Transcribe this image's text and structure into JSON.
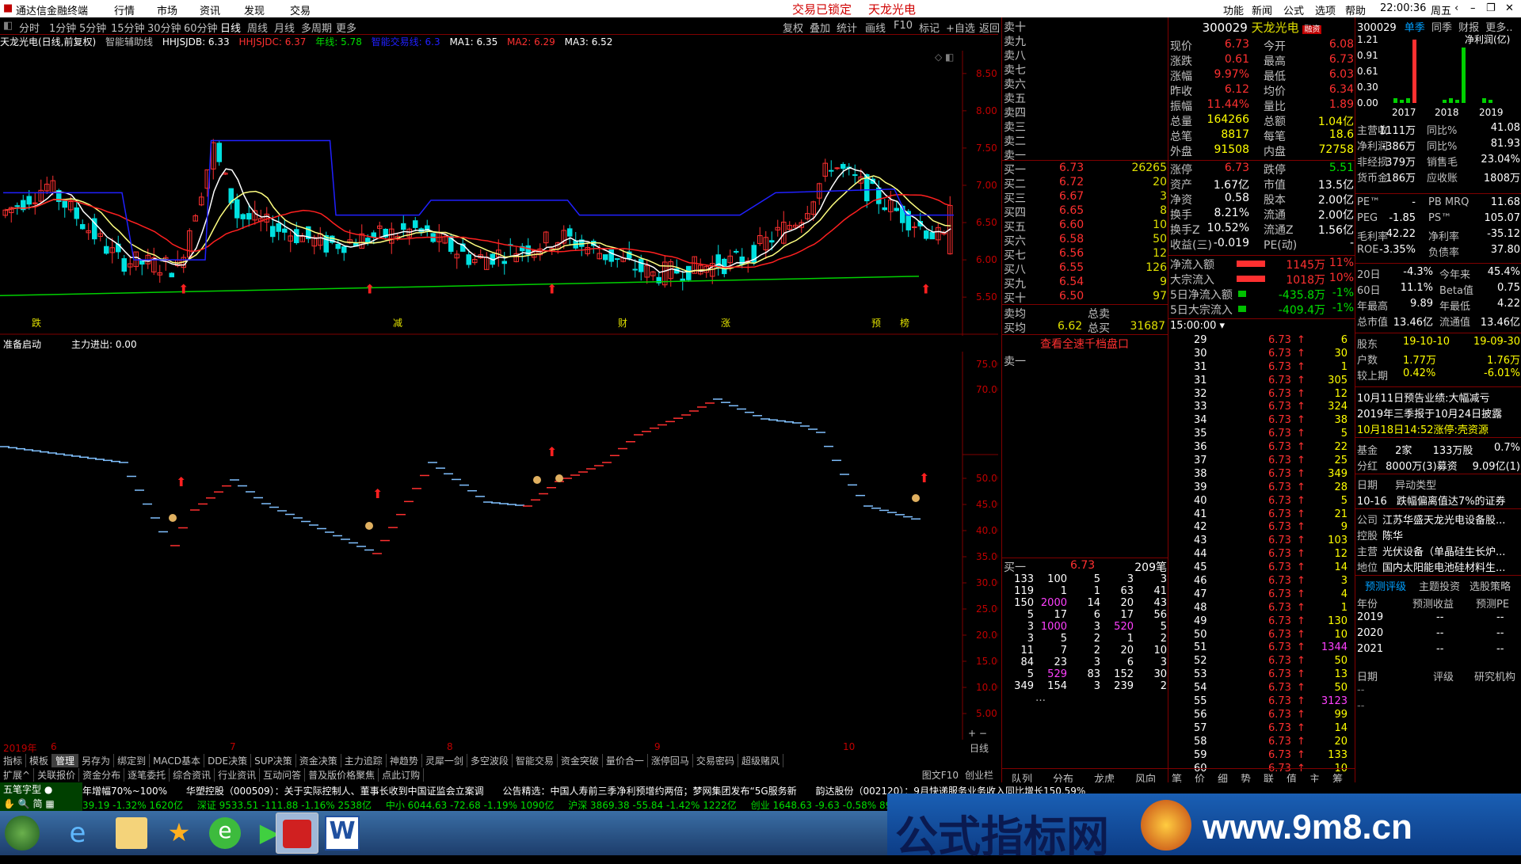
{
  "menubar": {
    "app_title": "通达信金融终端",
    "menus": [
      "行情",
      "市场",
      "资讯",
      "发现",
      "交易"
    ],
    "center_status": "交易已锁定",
    "center_stock": "天龙光电",
    "right_menus": [
      "功能",
      "新闻",
      "公式",
      "选项",
      "帮助"
    ],
    "time": "22:00:36",
    "weekday": "周五"
  },
  "periodbar": {
    "periods": [
      "分时",
      "1分钟",
      "5分钟",
      "15分钟",
      "30分钟",
      "60分钟",
      "日线",
      "周线",
      "月线",
      "多周期",
      "更多"
    ],
    "tools": [
      "复权",
      "叠加",
      "统计",
      "画线",
      "F10",
      "标记",
      "+自选",
      "返回"
    ]
  },
  "indicator_line": {
    "title": "天龙光电(日线,前复权)",
    "aux": "智能辅助线",
    "hhjsjdb": "HHJSJDB: 6.33",
    "hhjsjdc": "HHJSJDC: 6.37",
    "yearline": "年线: 5.78",
    "smart": "智能交易线: 6.3",
    "ma1": "MA1: 6.35",
    "ma2": "MA2: 6.29",
    "ma3": "MA3: 6.52"
  },
  "main_chart": {
    "price_axis": [
      "8.50",
      "8.00",
      "7.50",
      "7.00",
      "6.50",
      "6.00",
      "5.50"
    ],
    "bottom_labels": [
      "跌",
      "减",
      "财",
      "涨",
      "预",
      "榜"
    ]
  },
  "sub_indicator": {
    "name": "准备启动",
    "value": "主力进出: 0.00",
    "axis_top": [
      "75.00",
      "70.00"
    ],
    "axis_bottom": [
      "50.00",
      "45.00",
      "40.00",
      "35.00",
      "30.00",
      "25.00",
      "20.00",
      "15.00",
      "10.00",
      "5.00"
    ]
  },
  "xaxis": {
    "labels": [
      "2019年",
      "6",
      "7",
      "8",
      "9",
      "10"
    ],
    "right": "日线"
  },
  "tabs1": [
    "指标",
    "模板",
    "管理",
    "另存为",
    "绑定到",
    "MACD基本",
    "DDE决策",
    "SUP决策",
    "资金决策",
    "主力追踪",
    "神趋势",
    "灵犀一剑",
    "多空波段",
    "智能交易",
    "资金突破",
    "量价合一",
    "涨停回马",
    "交易密码",
    "超级赌风"
  ],
  "tabs2": [
    "扩展^",
    "关联报价",
    "资金分布",
    "逐笔委托",
    "综合资讯",
    "行业资讯",
    "互动问答",
    "普及版价格聚焦",
    "点此订购"
  ],
  "tabs2_right": [
    "图文F10",
    "创业栏"
  ],
  "order_book": {
    "sells": [
      "卖十",
      "卖九",
      "卖八",
      "卖七",
      "卖六",
      "卖五",
      "卖四",
      "卖三",
      "卖二",
      "卖一"
    ],
    "buys": [
      {
        "label": "买一",
        "price": "6.73",
        "vol": "26265"
      },
      {
        "label": "买二",
        "price": "6.72",
        "vol": "20"
      },
      {
        "label": "买三",
        "price": "6.67",
        "vol": "3"
      },
      {
        "label": "买四",
        "price": "6.65",
        "vol": "8"
      },
      {
        "label": "买五",
        "price": "6.60",
        "vol": "10"
      },
      {
        "label": "买六",
        "price": "6.58",
        "vol": "50"
      },
      {
        "label": "买七",
        "price": "6.56",
        "vol": "12"
      },
      {
        "label": "买八",
        "price": "6.55",
        "vol": "126"
      },
      {
        "label": "买九",
        "price": "6.54",
        "vol": "9"
      },
      {
        "label": "买十",
        "price": "6.50",
        "vol": "97"
      }
    ],
    "sell_avg": "卖均",
    "buy_avg": "买均",
    "buy_avg_price": "6.62",
    "total_sell": "总卖",
    "total_buy": "总买",
    "total_buy_val": "31687",
    "link": "查看全速千档盘口",
    "sell1_label": "卖一",
    "buy1_detail": {
      "label": "买一",
      "price": "6.73",
      "count": "209笔"
    },
    "queue": [
      [
        "133",
        "100",
        "5",
        "3",
        "3"
      ],
      [
        "119",
        "1",
        "1",
        "63",
        "41"
      ],
      [
        "150",
        "2000",
        "14",
        "20",
        "43"
      ],
      [
        "5",
        "17",
        "6",
        "17",
        "56"
      ],
      [
        "3",
        "1000",
        "3",
        "520",
        "5"
      ],
      [
        "3",
        "5",
        "2",
        "1",
        "2"
      ],
      [
        "11",
        "7",
        "2",
        "20",
        "10"
      ],
      [
        "84",
        "23",
        "3",
        "6",
        "3"
      ],
      [
        "5",
        "529",
        "83",
        "152",
        "30"
      ],
      [
        "349",
        "154",
        "3",
        "239",
        "2"
      ]
    ],
    "bottom_tabs": [
      "队列",
      "分布",
      "龙虎",
      "风向"
    ]
  },
  "quote": {
    "code": "300029",
    "name": "天龙光电",
    "badge": "融资",
    "rows": [
      [
        "现价",
        "6.73",
        "今开",
        "6.08"
      ],
      [
        "涨跌",
        "0.61",
        "最高",
        "6.73"
      ],
      [
        "涨幅",
        "9.97%",
        "最低",
        "6.03"
      ],
      [
        "昨收",
        "6.12",
        "均价",
        "6.34"
      ],
      [
        "振幅",
        "11.44%",
        "量比",
        "1.89"
      ],
      [
        "总量",
        "164266",
        "总额",
        "1.04亿"
      ],
      [
        "总笔",
        "8817",
        "每笔",
        "18.6"
      ],
      [
        "外盘",
        "91508",
        "内盘",
        "72758"
      ]
    ],
    "rows2": [
      [
        "涨停",
        "6.73",
        "跌停",
        "5.51"
      ],
      [
        "资产",
        "1.67亿",
        "市值",
        "13.5亿"
      ],
      [
        "净资",
        "0.58",
        "股本",
        "2.00亿"
      ],
      [
        "换手",
        "8.21%",
        "流通",
        "2.00亿"
      ],
      [
        "换手Z",
        "10.52%",
        "流通Z",
        "1.56亿"
      ],
      [
        "收益(三)",
        "-0.019",
        "PE(动)",
        "-"
      ]
    ],
    "flows": [
      [
        "净流入额",
        "1145万",
        "11%"
      ],
      [
        "大宗流入",
        "1018万",
        "10%"
      ],
      [
        "5日净流入额",
        "-435.8万",
        "-1%"
      ],
      [
        "5日大宗流入",
        "-409.4万",
        "-1%"
      ]
    ]
  },
  "ticks": {
    "header": "15:00:00",
    "rows": [
      [
        "29",
        "6.73",
        "6"
      ],
      [
        "30",
        "6.73",
        "30"
      ],
      [
        "31",
        "6.73",
        "1"
      ],
      [
        "31",
        "6.73",
        "305"
      ],
      [
        "32",
        "6.73",
        "12"
      ],
      [
        "33",
        "6.73",
        "324"
      ],
      [
        "34",
        "6.73",
        "38"
      ],
      [
        "35",
        "6.73",
        "5"
      ],
      [
        "36",
        "6.73",
        "22"
      ],
      [
        "37",
        "6.73",
        "25"
      ],
      [
        "38",
        "6.73",
        "349"
      ],
      [
        "39",
        "6.73",
        "28"
      ],
      [
        "40",
        "6.73",
        "5"
      ],
      [
        "41",
        "6.73",
        "21"
      ],
      [
        "42",
        "6.73",
        "9"
      ],
      [
        "43",
        "6.73",
        "103"
      ],
      [
        "44",
        "6.73",
        "12"
      ],
      [
        "45",
        "6.73",
        "14"
      ],
      [
        "46",
        "6.73",
        "3"
      ],
      [
        "47",
        "6.73",
        "4"
      ],
      [
        "48",
        "6.73",
        "1"
      ],
      [
        "49",
        "6.73",
        "130"
      ],
      [
        "50",
        "6.73",
        "10"
      ],
      [
        "51",
        "6.73",
        "1344"
      ],
      [
        "52",
        "6.73",
        "50"
      ],
      [
        "53",
        "6.73",
        "13"
      ],
      [
        "54",
        "6.73",
        "50"
      ],
      [
        "55",
        "6.73",
        "3123"
      ],
      [
        "56",
        "6.73",
        "99"
      ],
      [
        "57",
        "6.73",
        "14"
      ],
      [
        "58",
        "6.73",
        "20"
      ],
      [
        "59",
        "6.73",
        "133"
      ],
      [
        "60",
        "6.73",
        "10"
      ]
    ],
    "bottom_tabs": [
      "笔",
      "价",
      "细",
      "势",
      "联",
      "值",
      "主",
      "筹"
    ]
  },
  "f10": {
    "code": "300029",
    "tabs": [
      "单季",
      "同季",
      "财报",
      "更多.."
    ],
    "chart_axis": [
      "1.21",
      "0.91",
      "0.61",
      "0.30",
      "0.00"
    ],
    "chart_title": "净利润(亿)",
    "years": [
      "2017",
      "2018",
      "2019"
    ],
    "fin": [
      [
        "主营收",
        "1111万",
        "同比%",
        "41.08"
      ],
      [
        "净利润",
        "-386万",
        "同比%",
        "81.93"
      ],
      [
        "非经损",
        "379万",
        "销售毛",
        "23.04%"
      ],
      [
        "货币金",
        "186万",
        "应收账",
        "1808万"
      ]
    ],
    "ratios": [
      [
        "PE™",
        "-",
        "PB MRQ",
        "11.68"
      ],
      [
        "PEG",
        "-1.85",
        "PS™",
        "105.07"
      ],
      [
        "毛利率",
        "42.22",
        "净利率",
        "-35.12"
      ],
      [
        "ROE",
        "-3.35%",
        "负债率",
        "37.80"
      ]
    ],
    "returns": [
      [
        "20日",
        "-4.3%",
        "今年来",
        "45.4%"
      ],
      [
        "60日",
        "11.1%",
        "Beta值",
        "0.75"
      ],
      [
        "年最高",
        "9.89",
        "年最低",
        "4.22"
      ],
      [
        "总市值",
        "13.46亿",
        "流通值",
        "13.46亿"
      ]
    ],
    "holders": [
      [
        "股东",
        "19-10-10",
        "19-09-30"
      ],
      [
        "户数",
        "1.77万",
        "1.76万"
      ],
      [
        "较上期",
        "0.42%",
        "-6.01%"
      ]
    ],
    "news": [
      "10月11日预告业绩:大幅减亏",
      "2019年三季报于10月24日披露",
      "10月18日14:52涨停:壳资源"
    ],
    "fund": [
      "基金",
      "2家",
      "133万股",
      "0.7%"
    ],
    "dividend": [
      "分红",
      "8000万(3)募资",
      "9.09亿(1)"
    ],
    "abnormal_header": [
      "日期",
      "异动类型"
    ],
    "abnormal": [
      "10-16",
      "跌幅偏离值达7%的证券"
    ],
    "company": [
      [
        "公司",
        "江苏华盛天龙光电设备股..."
      ],
      [
        "控股",
        "陈华"
      ],
      [
        "主营",
        "光伏设备（单晶硅生长炉..."
      ],
      [
        "地位",
        "国内太阳能电池硅材料生..."
      ]
    ],
    "forecast_tabs": [
      "预测评级",
      "主题投资",
      "选股策略"
    ],
    "forecast_header": [
      "年份",
      "预测收益",
      "预测PE"
    ],
    "forecast_rows": [
      [
        "2019",
        "--",
        "--"
      ],
      [
        "2020",
        "--",
        "--"
      ],
      [
        "2021",
        "--",
        "--"
      ]
    ],
    "rating_header": [
      "日期",
      "评级",
      "研究机构"
    ]
  },
  "ticker": {
    "news1": "年增幅70%~100%",
    "news2": "华塑控股（000509）：关于实际控制人、董事长收到中国证监会立案调",
    "news3": "公告精选：中国人寿前三季净利预增约两倍；梦网集团发布“5G服务新",
    "news4": "韵达股份（002120）：9月快递服务业务收入同比增长150.59%",
    "index1": "39.19  -1.32%  1620亿",
    "index2": "深证 9533.51  -111.88  -1.16%  2538亿",
    "index3": "中小 6044.63  -72.68  -1.19%  1090亿",
    "index4": "沪深 3869.38  -55.84  -1.42%  1222亿",
    "index5": "创业 1648.63  -9.63  -0.58%  893.0亿",
    "ime": "五笔字型"
  },
  "watermark": {
    "text": "公式指标网",
    "url": "www.9m8.cn"
  },
  "colors": {
    "up": "#ff3030",
    "down": "#00e0e0",
    "ma_white": "#ffffff",
    "ma_yellow": "#ffff80",
    "ma_red": "#ff2020",
    "blue_line": "#2020ff",
    "green_line": "#00d000",
    "magenta": "#ff00ff"
  }
}
